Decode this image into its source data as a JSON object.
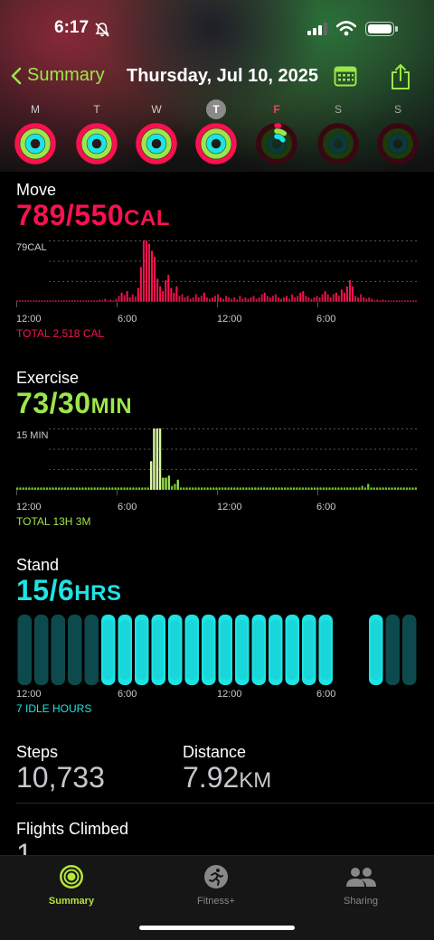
{
  "status": {
    "time": "6:17"
  },
  "nav": {
    "back_label": "Summary",
    "title": "Thursday, Jul 10, 2025"
  },
  "week": [
    {
      "letter": "M",
      "state": "past",
      "move": 1.0,
      "exercise": 1.0,
      "stand": 1.0
    },
    {
      "letter": "T",
      "state": "past",
      "move": 1.0,
      "exercise": 1.0,
      "stand": 1.0
    },
    {
      "letter": "W",
      "state": "past",
      "move": 1.0,
      "exercise": 1.0,
      "stand": 1.0
    },
    {
      "letter": "T",
      "state": "today",
      "move": 1.0,
      "exercise": 1.0,
      "stand": 1.0
    },
    {
      "letter": "F",
      "state": "future",
      "move": 0.02,
      "exercise": 0.1,
      "stand": 0.16
    },
    {
      "letter": "S",
      "state": "empty",
      "move": 0,
      "exercise": 0,
      "stand": 0
    },
    {
      "letter": "S",
      "state": "empty",
      "move": 0,
      "exercise": 0,
      "stand": 0
    }
  ],
  "colors": {
    "move": "#fa114f",
    "exercise": "#9ce64a",
    "stand": "#1ee3e3",
    "accent": "#9ce64a"
  },
  "move": {
    "label": "Move",
    "value": "789/550",
    "unit": "CAL",
    "max_label": "79CAL",
    "total": "TOTAL 2,518 CAL",
    "ticks": [
      "12:00",
      "6:00",
      "12:00",
      "6:00"
    ]
  },
  "exercise": {
    "label": "Exercise",
    "value": "73/30",
    "unit": "MIN",
    "max_label": "15 MIN",
    "total": "TOTAL 13H 3M",
    "ticks": [
      "12:00",
      "6:00",
      "12:00",
      "6:00"
    ]
  },
  "stand": {
    "label": "Stand",
    "value": "15/6",
    "unit": "HRS",
    "idle": "7 IDLE HOURS",
    "ticks": [
      "12:00",
      "6:00",
      "12:00",
      "6:00"
    ]
  },
  "chart_data": [
    {
      "type": "bar",
      "title": "Move",
      "ylabel": "79CAL",
      "ylim": [
        0,
        79
      ],
      "values": [
        2,
        2,
        2,
        2,
        2,
        2,
        2,
        2,
        2,
        2,
        2,
        2,
        2,
        2,
        2,
        2,
        2,
        2,
        2,
        2,
        2,
        2,
        2,
        2,
        2,
        2,
        2,
        2,
        2,
        2,
        3,
        2,
        4,
        2,
        3,
        2,
        4,
        8,
        12,
        9,
        14,
        6,
        10,
        7,
        18,
        45,
        79,
        79,
        75,
        66,
        58,
        30,
        20,
        14,
        28,
        35,
        18,
        12,
        20,
        8,
        10,
        6,
        8,
        4,
        6,
        10,
        6,
        8,
        12,
        6,
        4,
        6,
        8,
        10,
        6,
        4,
        8,
        6,
        4,
        6,
        3,
        8,
        4,
        6,
        4,
        6,
        8,
        4,
        6,
        10,
        12,
        8,
        6,
        8,
        10,
        6,
        4,
        6,
        8,
        4,
        10,
        6,
        8,
        12,
        14,
        8,
        6,
        4,
        6,
        8,
        6,
        10,
        14,
        10,
        6,
        10,
        12,
        8,
        16,
        12,
        20,
        28,
        20,
        8,
        6,
        10,
        6,
        4,
        6,
        4,
        2,
        3,
        2,
        3,
        2,
        2,
        2,
        2,
        2,
        2,
        2,
        2,
        2,
        2,
        2,
        2
      ],
      "total": "TOTAL 2,518 CAL"
    },
    {
      "type": "bar",
      "title": "Exercise",
      "ylabel": "15 MIN",
      "ylim": [
        0,
        15
      ],
      "values": [
        0.6,
        0.6,
        0.6,
        0.6,
        0.6,
        0.6,
        0.6,
        0.6,
        0.6,
        0.6,
        0.6,
        0.6,
        0.6,
        0.6,
        0.6,
        0.6,
        0.6,
        0.6,
        0.6,
        0.6,
        0.6,
        0.6,
        0.6,
        0.6,
        0.6,
        0.6,
        0.6,
        0.6,
        0.6,
        0.6,
        0.6,
        0.6,
        0.6,
        0.6,
        0.6,
        0.6,
        0.6,
        0.6,
        0.6,
        0.6,
        0.6,
        0.6,
        0.6,
        0.6,
        0.6,
        7,
        15,
        15,
        15,
        3,
        3,
        3.5,
        1,
        1.5,
        2.5,
        0.6,
        0.6,
        0.6,
        0.6,
        0.6,
        0.6,
        0.6,
        0.6,
        0.6,
        0.6,
        0.6,
        0.6,
        0.6,
        0.6,
        0.6,
        0.6,
        0.6,
        0.6,
        0.6,
        0.6,
        0.6,
        0.6,
        0.6,
        0.6,
        0.6,
        0.6,
        0.6,
        0.6,
        0.6,
        0.6,
        0.6,
        0.6,
        0.6,
        0.6,
        0.6,
        0.6,
        0.6,
        0.6,
        0.6,
        0.6,
        0.6,
        0.6,
        0.6,
        0.6,
        0.6,
        0.6,
        0.6,
        0.6,
        0.6,
        0.6,
        0.6,
        0.6,
        0.6,
        0.6,
        0.6,
        0.6,
        0.6,
        0.6,
        0.6,
        0.6,
        0.6,
        1,
        0.6,
        1.5,
        0.6,
        0.6,
        0.6,
        0.6,
        0.6,
        0.6,
        0.6,
        0.6,
        0.6,
        0.6,
        0.6,
        0.6,
        0.6,
        0.6,
        0.6,
        0.6
      ],
      "total": "TOTAL 13H 3M"
    },
    {
      "type": "bar",
      "title": "Stand",
      "categories": [
        "12AM",
        "1AM",
        "2AM",
        "3AM",
        "4AM",
        "5AM",
        "6AM",
        "7AM",
        "8AM",
        "9AM",
        "10AM",
        "11AM",
        "12PM",
        "1PM",
        "2PM",
        "3PM",
        "4PM",
        "5PM",
        "6PM",
        "7PM",
        "8PM",
        "9PM",
        "10PM",
        "11PM"
      ],
      "values": [
        0,
        0,
        0,
        0,
        0,
        1,
        1,
        1,
        1,
        1,
        1,
        1,
        1,
        1,
        1,
        1,
        1,
        1,
        1,
        -1,
        -1,
        1,
        0,
        0
      ],
      "total": "7 IDLE HOURS"
    }
  ],
  "steps": {
    "label": "Steps",
    "value": "10,733"
  },
  "distance": {
    "label": "Distance",
    "value": "7.92",
    "unit": "KM"
  },
  "flights": {
    "label": "Flights Climbed",
    "value": "1"
  },
  "tabs": [
    {
      "label": "Summary",
      "icon": "activity-rings-icon",
      "active": true
    },
    {
      "label": "Fitness+",
      "icon": "fitness-plus-icon",
      "active": false
    },
    {
      "label": "Sharing",
      "icon": "sharing-people-icon",
      "active": false
    }
  ]
}
